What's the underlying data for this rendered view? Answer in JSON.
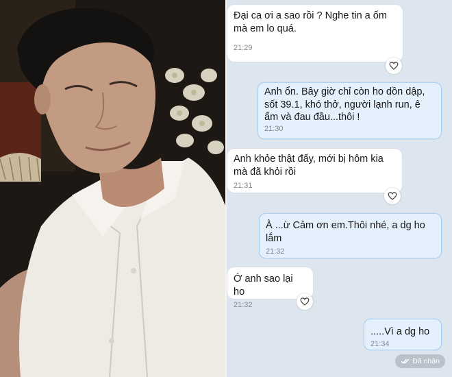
{
  "chat": {
    "messages": [
      {
        "direction": "incoming",
        "text": "Đại ca ơi a sao rồi ? Nghe tin a ốm mà em lo quá.",
        "time": "21:29",
        "reaction_icon": "heart-outline"
      },
      {
        "direction": "outgoing",
        "text": "Anh ổn. Bây giờ chỉ còn ho dồn dập, sốt 39.1,  khó thở, người lạnh run, ê ẩm và đau đầu...thôi !",
        "time": "21:30"
      },
      {
        "direction": "incoming",
        "text": "Anh khỏe thật đấy, mới bị hôm kia mà đã khỏi rồi",
        "time": "21:31",
        "reaction_icon": "heart-outline"
      },
      {
        "direction": "outgoing",
        "text": "À ...ừ Cảm ơn em.Thôi nhé, a dg ho lắm",
        "time": "21:32"
      },
      {
        "direction": "incoming",
        "text": "Ớ anh sao lại ho",
        "time": "21:32",
        "reaction_icon": "heart-outline"
      },
      {
        "direction": "outgoing",
        "text": ".....Vì a dg ho",
        "time": "21:34"
      }
    ],
    "delivery_status": "Đã nhận",
    "delivery_icon": "double-check",
    "colors": {
      "background": "#dde5ee",
      "incoming_bubble": "#ffffff",
      "outgoing_bubble": "#e4f1fd",
      "outgoing_border": "#a9d2f6"
    }
  }
}
